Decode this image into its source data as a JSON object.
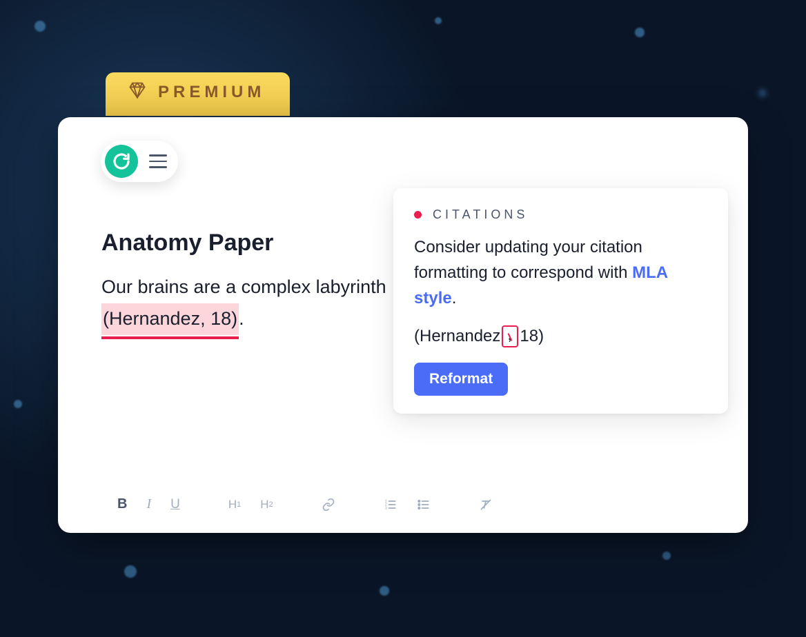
{
  "premium": {
    "label": "PREMIUM"
  },
  "document": {
    "title": "Anatomy Paper",
    "body_prefix": "Our brains are a complex labyrinth ",
    "citation_highlight": "(Hernandez, 18)",
    "body_suffix": "."
  },
  "suggestion": {
    "category": "CITATIONS",
    "message_prefix": "Consider updating your citation formatting to correspond with ",
    "style_link": "MLA style",
    "message_suffix": ".",
    "example_before": "(Hernandez",
    "example_after": "18)",
    "action_label": "Reformat"
  },
  "toolbar": {
    "bold": "B",
    "italic": "I",
    "underline": "U",
    "h1": "H1",
    "h2": "H2"
  }
}
